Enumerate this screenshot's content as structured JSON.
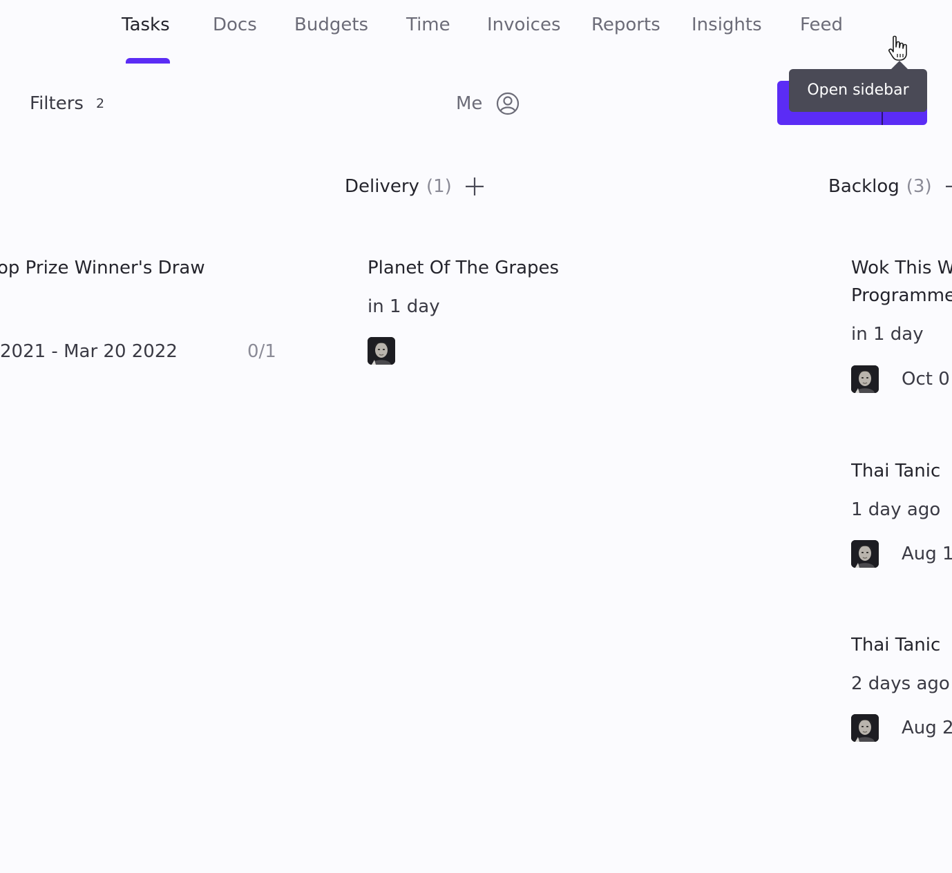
{
  "nav": {
    "tabs": [
      {
        "label": "Tasks"
      },
      {
        "label": "Docs"
      },
      {
        "label": "Budgets"
      },
      {
        "label": "Time"
      },
      {
        "label": "Invoices"
      },
      {
        "label": "Reports"
      },
      {
        "label": "Insights"
      },
      {
        "label": "Feed"
      }
    ],
    "active_tab": "Tasks"
  },
  "toolbar": {
    "filters_label": "Filters",
    "filters_count": "2",
    "me_label": "Me",
    "tooltip": "Open sidebar",
    "primary_color": "#5b2cf5"
  },
  "columns": [
    {
      "cards": [
        {
          "title": "op Prize Winner's Draw",
          "dates": "2021 - Mar 20 2022",
          "progress": "0/1"
        }
      ]
    },
    {
      "title": "Delivery",
      "count": "(1)",
      "cards": [
        {
          "title": "Planet Of The Grapes",
          "due": "in 1 day"
        }
      ]
    },
    {
      "title": "Backlog",
      "count": "(3)",
      "cards": [
        {
          "title_line1": "Wok This W",
          "title_line2": "Programme",
          "due": "in 1 day",
          "date": "Oct 0"
        },
        {
          "title": "Thai Tanic",
          "due": "1 day ago",
          "date": "Aug 1"
        },
        {
          "title": "Thai Tanic",
          "due": "2 days ago",
          "date": "Aug 2"
        }
      ]
    }
  ]
}
